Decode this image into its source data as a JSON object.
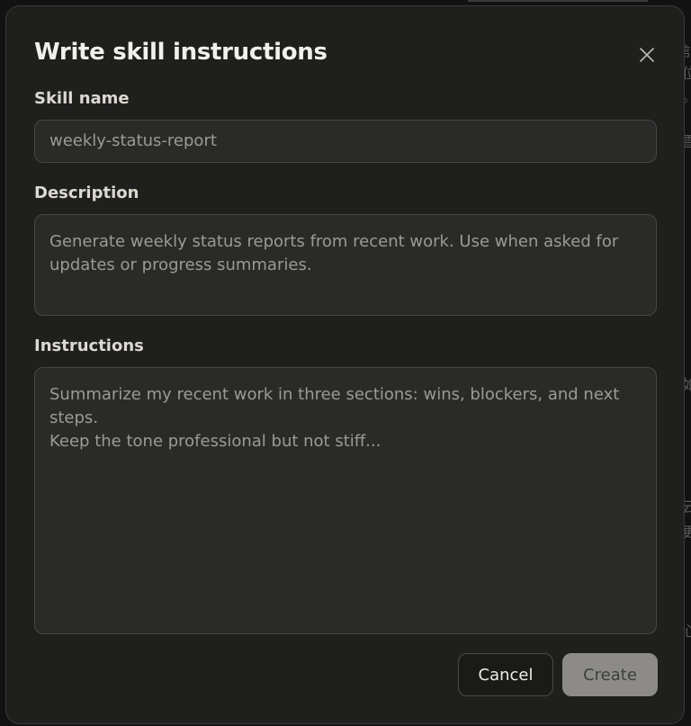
{
  "dialog": {
    "title": "Write skill instructions",
    "close_icon": "close-icon"
  },
  "fields": {
    "skill_name": {
      "label": "Skill name",
      "value": "weekly-status-report"
    },
    "description": {
      "label": "Description",
      "placeholder_lines": [
        "Generate weekly status reports from recent work. Use when asked for",
        "updates or progress summaries."
      ]
    },
    "instructions": {
      "label": "Instructions",
      "placeholder_lines": [
        "Summarize my recent work in three sections: wins, blockers, and next steps.",
        "Keep the tone professional but not stiff..."
      ]
    }
  },
  "buttons": {
    "cancel": "Cancel",
    "create": "Create"
  },
  "background_glyphs": [
    "訁",
    "位",
    "。",
    "雪",
    "如",
    "云",
    "更",
    "心"
  ],
  "colors": {
    "dialog_bg": "#1f1f1e",
    "field_bg": "#2a2a29",
    "create_disabled_bg": "#8c8b87"
  }
}
